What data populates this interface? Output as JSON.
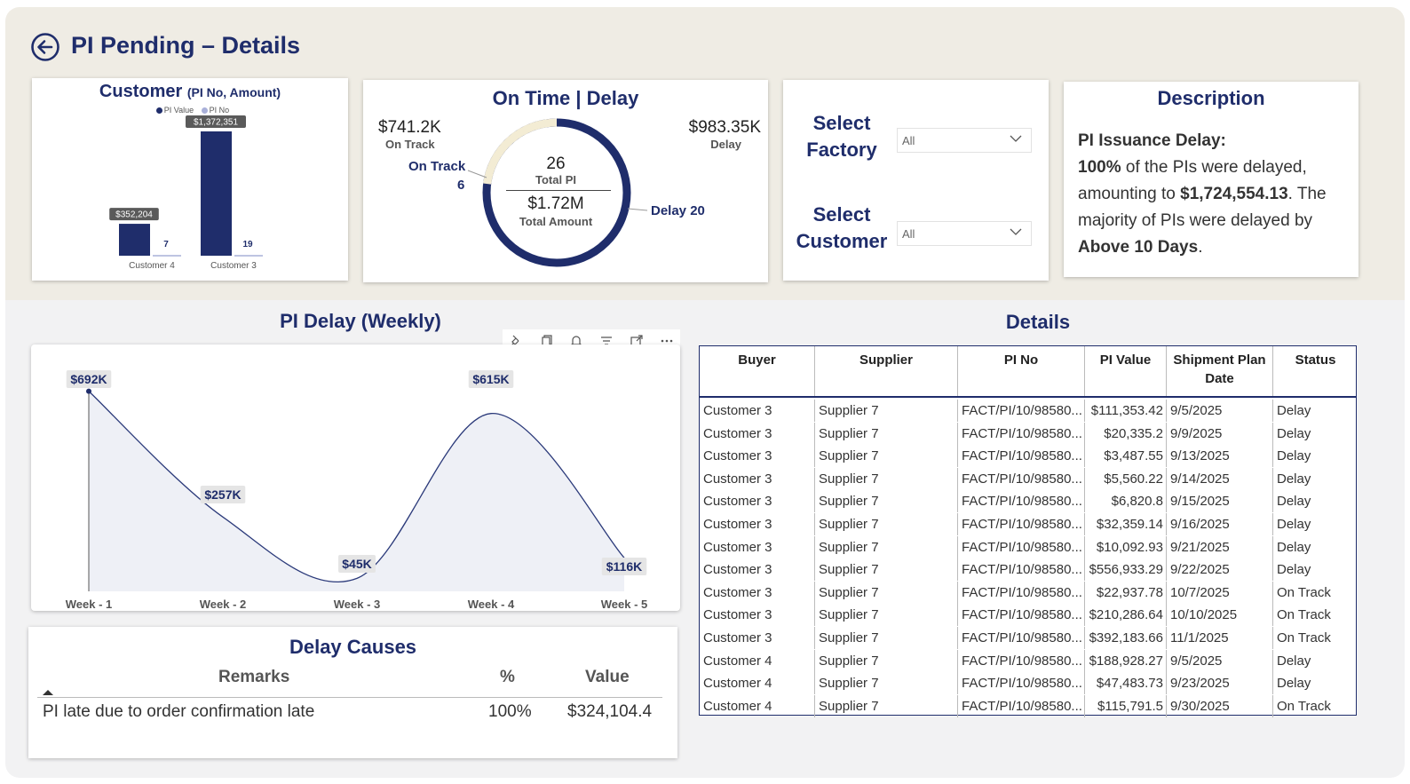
{
  "header": {
    "title": "PI Pending – Details"
  },
  "customer_card": {
    "title": "Customer",
    "subtitle": "(PI No, Amount)",
    "legend": [
      "PI Value",
      "PI No"
    ],
    "colors": {
      "pi_value": "#1f2d6b",
      "pi_no": "#a9b0d9"
    }
  },
  "on_time_card": {
    "title": "On Time | Delay",
    "on_track_amount": "$741.2K",
    "on_track_label": "On Track",
    "delay_amount": "$983.35K",
    "delay_label": "Delay",
    "on_track_count_label": "On Track",
    "on_track_count": "6",
    "delay_count_label": "Delay 20",
    "total_pi": "26",
    "total_pi_label": "Total PI",
    "total_amount": "$1.72M",
    "total_amount_label": "Total Amount",
    "on_track_share": 0.23,
    "colors": {
      "delay": "#1f2d6b",
      "on_track": "#f3ecd4"
    }
  },
  "slicers": {
    "factory_label_1": "Select",
    "factory_label_2": "Factory",
    "factory_value": "All",
    "customer_label_1": "Select",
    "customer_label_2": "Customer",
    "customer_value": "All"
  },
  "description": {
    "title": "Description",
    "heading": "PI Issuance Delay:",
    "pct": "100%",
    "text1": " of the PIs were delayed, amounting to ",
    "amount": "$1,724,554.13",
    "text2": ". The majority of PIs were delayed by ",
    "bucket": "Above 10 Days",
    "text3": "."
  },
  "weekly": {
    "title": "PI Delay (Weekly)"
  },
  "details": {
    "title": "Details",
    "columns": [
      "Buyer",
      "Supplier",
      "PI No",
      "PI Value",
      "Shipment Plan Date",
      "Status"
    ],
    "rows": [
      [
        "Customer 3",
        "Supplier 7",
        "FACT/PI/10/98580...",
        "$111,353.42",
        "9/5/2025",
        "Delay"
      ],
      [
        "Customer 3",
        "Supplier 7",
        "FACT/PI/10/98580...",
        "$20,335.2",
        "9/9/2025",
        "Delay"
      ],
      [
        "Customer 3",
        "Supplier 7",
        "FACT/PI/10/98580...",
        "$3,487.55",
        "9/13/2025",
        "Delay"
      ],
      [
        "Customer 3",
        "Supplier 7",
        "FACT/PI/10/98580...",
        "$5,560.22",
        "9/14/2025",
        "Delay"
      ],
      [
        "Customer 3",
        "Supplier 7",
        "FACT/PI/10/98580...",
        "$6,820.8",
        "9/15/2025",
        "Delay"
      ],
      [
        "Customer 3",
        "Supplier 7",
        "FACT/PI/10/98580...",
        "$32,359.14",
        "9/16/2025",
        "Delay"
      ],
      [
        "Customer 3",
        "Supplier 7",
        "FACT/PI/10/98580...",
        "$10,092.93",
        "9/21/2025",
        "Delay"
      ],
      [
        "Customer 3",
        "Supplier 7",
        "FACT/PI/10/98580...",
        "$556,933.29",
        "9/22/2025",
        "Delay"
      ],
      [
        "Customer 3",
        "Supplier 7",
        "FACT/PI/10/98580...",
        "$22,937.78",
        "10/7/2025",
        "On Track"
      ],
      [
        "Customer 3",
        "Supplier 7",
        "FACT/PI/10/98580...",
        "$210,286.64",
        "10/10/2025",
        "On Track"
      ],
      [
        "Customer 3",
        "Supplier 7",
        "FACT/PI/10/98580...",
        "$392,183.66",
        "11/1/2025",
        "On Track"
      ],
      [
        "Customer 4",
        "Supplier 7",
        "FACT/PI/10/98580...",
        "$188,928.27",
        "9/5/2025",
        "Delay"
      ],
      [
        "Customer 4",
        "Supplier 7",
        "FACT/PI/10/98580...",
        "$47,483.73",
        "9/23/2025",
        "Delay"
      ],
      [
        "Customer 4",
        "Supplier 7",
        "FACT/PI/10/98580...",
        "$115,791.5",
        "9/30/2025",
        "On Track"
      ]
    ]
  },
  "delay_causes": {
    "title": "Delay Causes",
    "columns": [
      "Remarks",
      "%",
      "Value"
    ],
    "rows": [
      [
        "PI late due to order confirmation late",
        "100%",
        "$324,104.4"
      ]
    ]
  },
  "chart_data": [
    {
      "type": "bar",
      "title": "Customer (PI No, Amount)",
      "categories": [
        "Customer 4",
        "Customer 3"
      ],
      "series": [
        {
          "name": "PI Value",
          "values": [
            352204,
            1372351
          ],
          "labels": [
            "$352,204",
            "$1,372,351"
          ]
        },
        {
          "name": "PI No",
          "values": [
            7,
            19
          ],
          "labels": [
            "7",
            "19"
          ]
        }
      ],
      "ylim": [
        0,
        1372351
      ],
      "legend": "top"
    },
    {
      "type": "pie",
      "title": "On Time | Delay",
      "categories": [
        "On Track",
        "Delay"
      ],
      "values": [
        741200,
        983350
      ],
      "counts": [
        6,
        20
      ]
    },
    {
      "type": "area",
      "title": "PI Delay (Weekly)",
      "x": [
        "Week - 1",
        "Week - 2",
        "Week - 3",
        "Week - 4",
        "Week - 5"
      ],
      "values": [
        692000,
        257000,
        45000,
        615000,
        116000
      ],
      "labels": [
        "$692K",
        "$257K",
        "$45K",
        "$615K",
        "$116K"
      ],
      "ylim": [
        0,
        700000
      ],
      "line_color": "#2b3a7a",
      "fill_color": "#eef0f6"
    }
  ]
}
